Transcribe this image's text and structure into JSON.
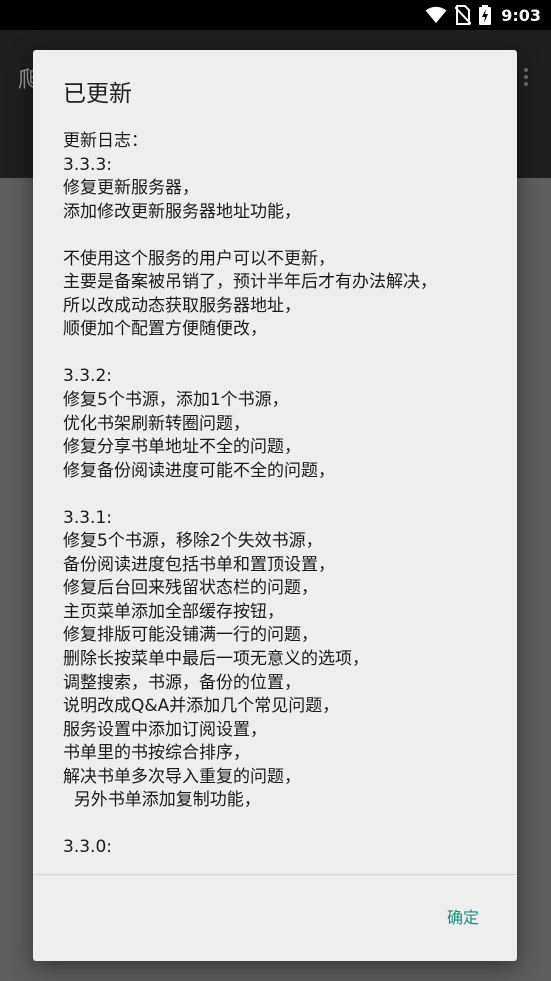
{
  "status_bar": {
    "time": "9:03",
    "icons": [
      "wifi-icon",
      "no-sim-icon",
      "battery-charging-icon"
    ]
  },
  "app_bar": {
    "title": "爬",
    "menu_icon": "overflow-menu-icon"
  },
  "dialog": {
    "title": "已更新",
    "message": "更新日志：\n3.3.3:\n修复更新服务器，\n添加修改更新服务器地址功能，\n\n不使用这个服务的用户可以不更新，\n主要是备案被吊销了，预计半年后才有办法解决，\n所以改成动态获取服务器地址，\n顺便加个配置方便随便改，\n\n3.3.2:\n修复5个书源，添加1个书源，\n优化书架刷新转圈问题，\n修复分享书单地址不全的问题，\n修复备份阅读进度可能不全的问题，\n\n3.3.1:\n修复5个书源，移除2个失效书源，\n备份阅读进度包括书单和置顶设置，\n修复后台回来残留状态栏的问题，\n主页菜单添加全部缓存按钮，\n修复排版可能没铺满一行的问题，\n删除长按菜单中最后一项无意义的选项，\n调整搜索，书源，备份的位置，\n说明改成Q&A并添加几个常见问题，\n服务设置中添加订阅设置，\n书单里的书按综合排序，\n解决书单多次导入重复的问题，\n  另外书单添加复制功能，\n\n3.3.0:",
    "ok_label": "确定"
  },
  "colors": {
    "accent": "#1a8d84",
    "dialog_bg": "#eeeeee",
    "scrim": "#5e5e5e",
    "status_bar": "#000000"
  }
}
